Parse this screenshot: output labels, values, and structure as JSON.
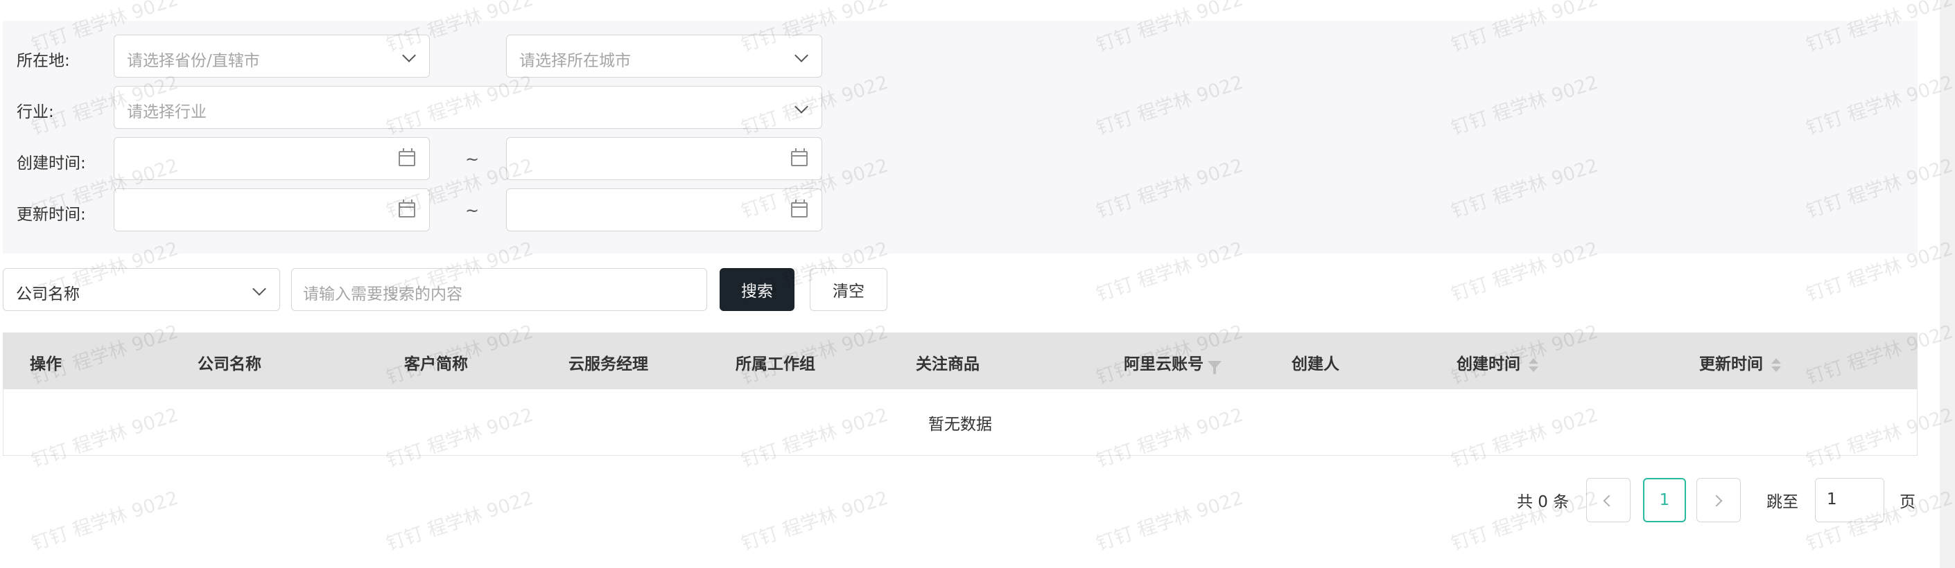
{
  "watermark": "钉钉  程学林 9022",
  "filters": {
    "location_label": "所在地:",
    "province_placeholder": "请选择省份/直辖市",
    "city_placeholder": "请选择所在城市",
    "industry_label": "行业:",
    "industry_placeholder": "请选择行业",
    "created_label": "创建时间:",
    "updated_label": "更新时间:",
    "range_separator": "~"
  },
  "search": {
    "field_selected": "公司名称",
    "placeholder": "请输入需要搜索的内容",
    "search_button": "搜索",
    "clear_button": "清空"
  },
  "table": {
    "columns": [
      "操作",
      "公司名称",
      "客户简称",
      "云服务经理",
      "所属工作组",
      "关注商品",
      "阿里云账号",
      "创建人",
      "创建时间",
      "更新时间"
    ],
    "empty_text": "暂无数据"
  },
  "pagination": {
    "total": "共 0 条",
    "current_page": "1",
    "jump_label": "跳至",
    "jump_value": "1",
    "page_suffix": "页"
  },
  "colors": {
    "primary_button": "#1b232b",
    "accent": "#2bb9a0",
    "panel_bg": "#f7f7f9",
    "header_bg": "#e3e3e3"
  }
}
